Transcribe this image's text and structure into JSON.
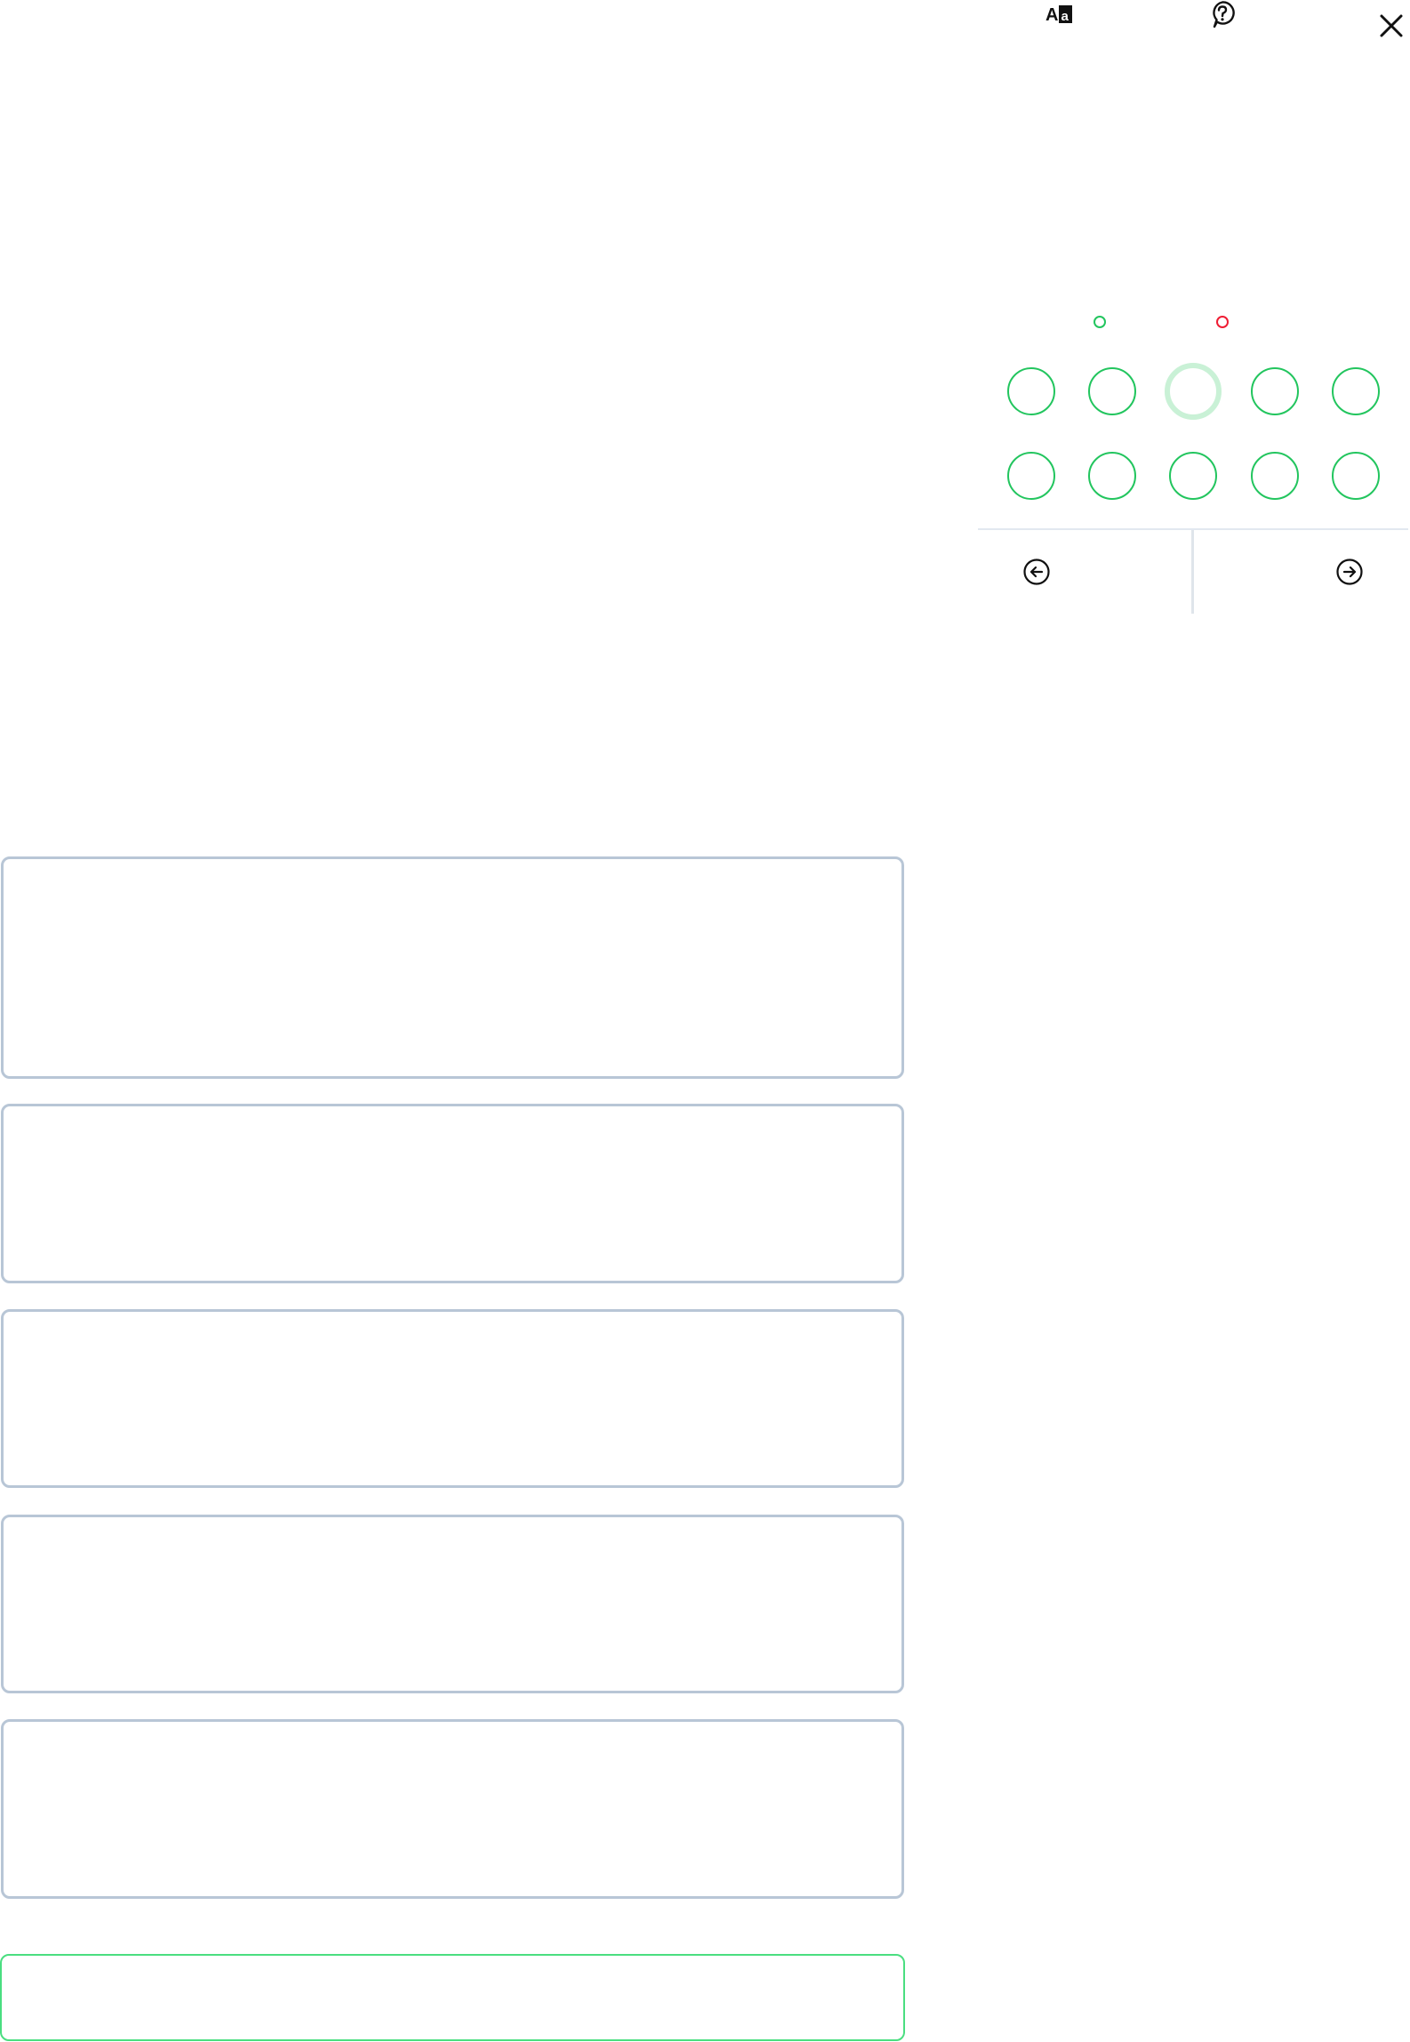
{
  "toolbar": {
    "translate_icon": "translate-icon",
    "help_icon": "help-icon",
    "close_icon": "close-icon"
  },
  "legend": {
    "answered_label": "",
    "unanswered_label": "",
    "answered_color": "#22c55e",
    "unanswered_color": "#ef1d34"
  },
  "navigator": {
    "bubble_color": "#22c55e",
    "current_ring_color": "#c9f1d6",
    "current_index": 3,
    "questions": [
      {
        "label": ""
      },
      {
        "label": ""
      },
      {
        "label": ""
      },
      {
        "label": ""
      },
      {
        "label": ""
      },
      {
        "label": ""
      },
      {
        "label": ""
      },
      {
        "label": ""
      },
      {
        "label": ""
      },
      {
        "label": ""
      }
    ]
  },
  "nav": {
    "prev_label": "",
    "next_label": "",
    "prev_icon": "arrow-left-circle-icon",
    "next_icon": "arrow-right-circle-icon"
  },
  "options": [
    {
      "text": ""
    },
    {
      "text": ""
    },
    {
      "text": ""
    },
    {
      "text": ""
    },
    {
      "text": ""
    }
  ],
  "submit": {
    "label": "",
    "border_color": "#4ade80"
  },
  "colors": {
    "card_border": "#b8c6d6",
    "divider": "#e2e8f0"
  }
}
